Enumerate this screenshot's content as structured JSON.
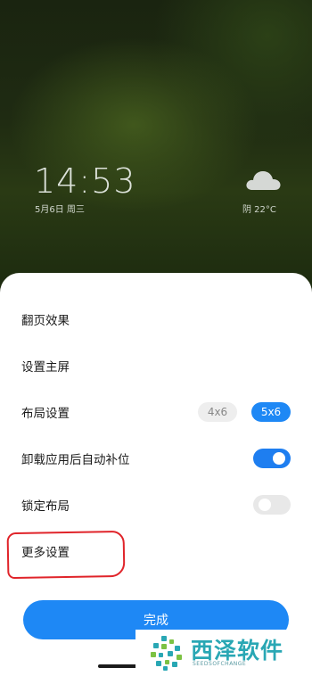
{
  "lockscreen": {
    "time": "14:53",
    "date": "5月6日 周三",
    "weather": "阴  22°C",
    "weather_icon": "cloud-icon"
  },
  "settings": {
    "page_flip": "翻页效果",
    "set_home": "设置主屏",
    "layout": {
      "label": "布局设置",
      "options": [
        "4x6",
        "5x6"
      ],
      "selected": "5x6"
    },
    "auto_fill": {
      "label": "卸载应用后自动补位",
      "on": true
    },
    "lock_layout": {
      "label": "锁定布局",
      "on": false
    },
    "more": "更多设置",
    "done": "完成"
  },
  "watermark": {
    "title": "西泽软件",
    "subtitle": "SEEDSOFCHANGE"
  },
  "colors": {
    "accent": "#1e88f5",
    "highlight": "#e0242a",
    "watermark": "#29a7b4"
  }
}
